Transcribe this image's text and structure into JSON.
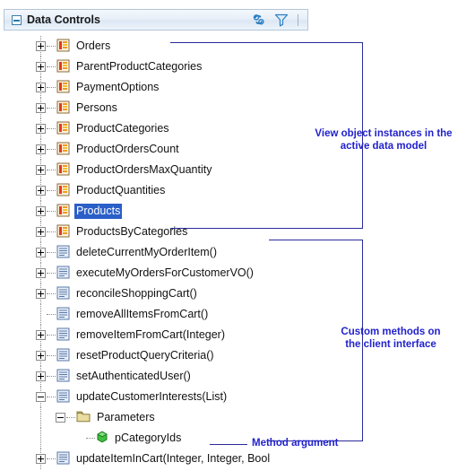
{
  "panel": {
    "title": "Data Controls",
    "collapse_icon": "minus-box-icon",
    "icons": [
      {
        "name": "refresh-sync-icon",
        "label": "Refresh"
      },
      {
        "name": "filter-funnel-icon",
        "label": "Filter"
      }
    ]
  },
  "tree": {
    "items": [
      {
        "label": "Orders",
        "icon": "view-object-icon",
        "expander": "plus",
        "depth": 1,
        "selected": false
      },
      {
        "label": "ParentProductCategories",
        "icon": "view-object-icon",
        "expander": "plus",
        "depth": 1,
        "selected": false
      },
      {
        "label": "PaymentOptions",
        "icon": "view-object-icon",
        "expander": "plus",
        "depth": 1,
        "selected": false
      },
      {
        "label": "Persons",
        "icon": "view-object-icon",
        "expander": "plus",
        "depth": 1,
        "selected": false
      },
      {
        "label": "ProductCategories",
        "icon": "view-object-icon",
        "expander": "plus",
        "depth": 1,
        "selected": false
      },
      {
        "label": "ProductOrdersCount",
        "icon": "view-object-icon",
        "expander": "plus",
        "depth": 1,
        "selected": false
      },
      {
        "label": "ProductOrdersMaxQuantity",
        "icon": "view-object-icon",
        "expander": "plus",
        "depth": 1,
        "selected": false
      },
      {
        "label": "ProductQuantities",
        "icon": "view-object-icon",
        "expander": "plus",
        "depth": 1,
        "selected": false
      },
      {
        "label": "Products",
        "icon": "view-object-icon",
        "expander": "plus",
        "depth": 1,
        "selected": true
      },
      {
        "label": "ProductsByCategories",
        "icon": "view-object-icon",
        "expander": "plus",
        "depth": 1,
        "selected": false
      },
      {
        "label": "deleteCurrentMyOrderItem()",
        "icon": "method-icon",
        "expander": "plus",
        "depth": 1,
        "selected": false
      },
      {
        "label": "executeMyOrdersForCustomerVO()",
        "icon": "method-icon",
        "expander": "plus",
        "depth": 1,
        "selected": false
      },
      {
        "label": "reconcileShoppingCart()",
        "icon": "method-icon",
        "expander": "plus",
        "depth": 1,
        "selected": false
      },
      {
        "label": "removeAllItemsFromCart()",
        "icon": "method-icon",
        "expander": "none",
        "depth": 1,
        "selected": false
      },
      {
        "label": "removeItemFromCart(Integer)",
        "icon": "method-icon",
        "expander": "plus",
        "depth": 1,
        "selected": false
      },
      {
        "label": "resetProductQueryCriteria()",
        "icon": "method-icon",
        "expander": "plus",
        "depth": 1,
        "selected": false
      },
      {
        "label": "setAuthenticatedUser()",
        "icon": "method-icon",
        "expander": "plus",
        "depth": 1,
        "selected": false
      },
      {
        "label": "updateCustomerInterests(List)",
        "icon": "method-icon",
        "expander": "minus",
        "depth": 1,
        "selected": false
      },
      {
        "label": "Parameters",
        "icon": "folder-icon",
        "expander": "minus",
        "depth": 2,
        "selected": false
      },
      {
        "label": "pCategoryIds",
        "icon": "parameter-cube-icon",
        "expander": "none",
        "depth": 3,
        "selected": false
      },
      {
        "label": "updateItemInCart(Integer, Integer, Bool",
        "icon": "method-icon",
        "expander": "plus",
        "depth": 1,
        "selected": false
      }
    ]
  },
  "annotations": {
    "view_objects": "View object instances in the\nactive data model",
    "custom_methods": "Custom methods on\nthe client interface",
    "method_argument": "Method argument"
  },
  "colors": {
    "annotation": "#2222cc",
    "selection": "#2a5fc8",
    "panel_border": "#b3c5d8"
  }
}
